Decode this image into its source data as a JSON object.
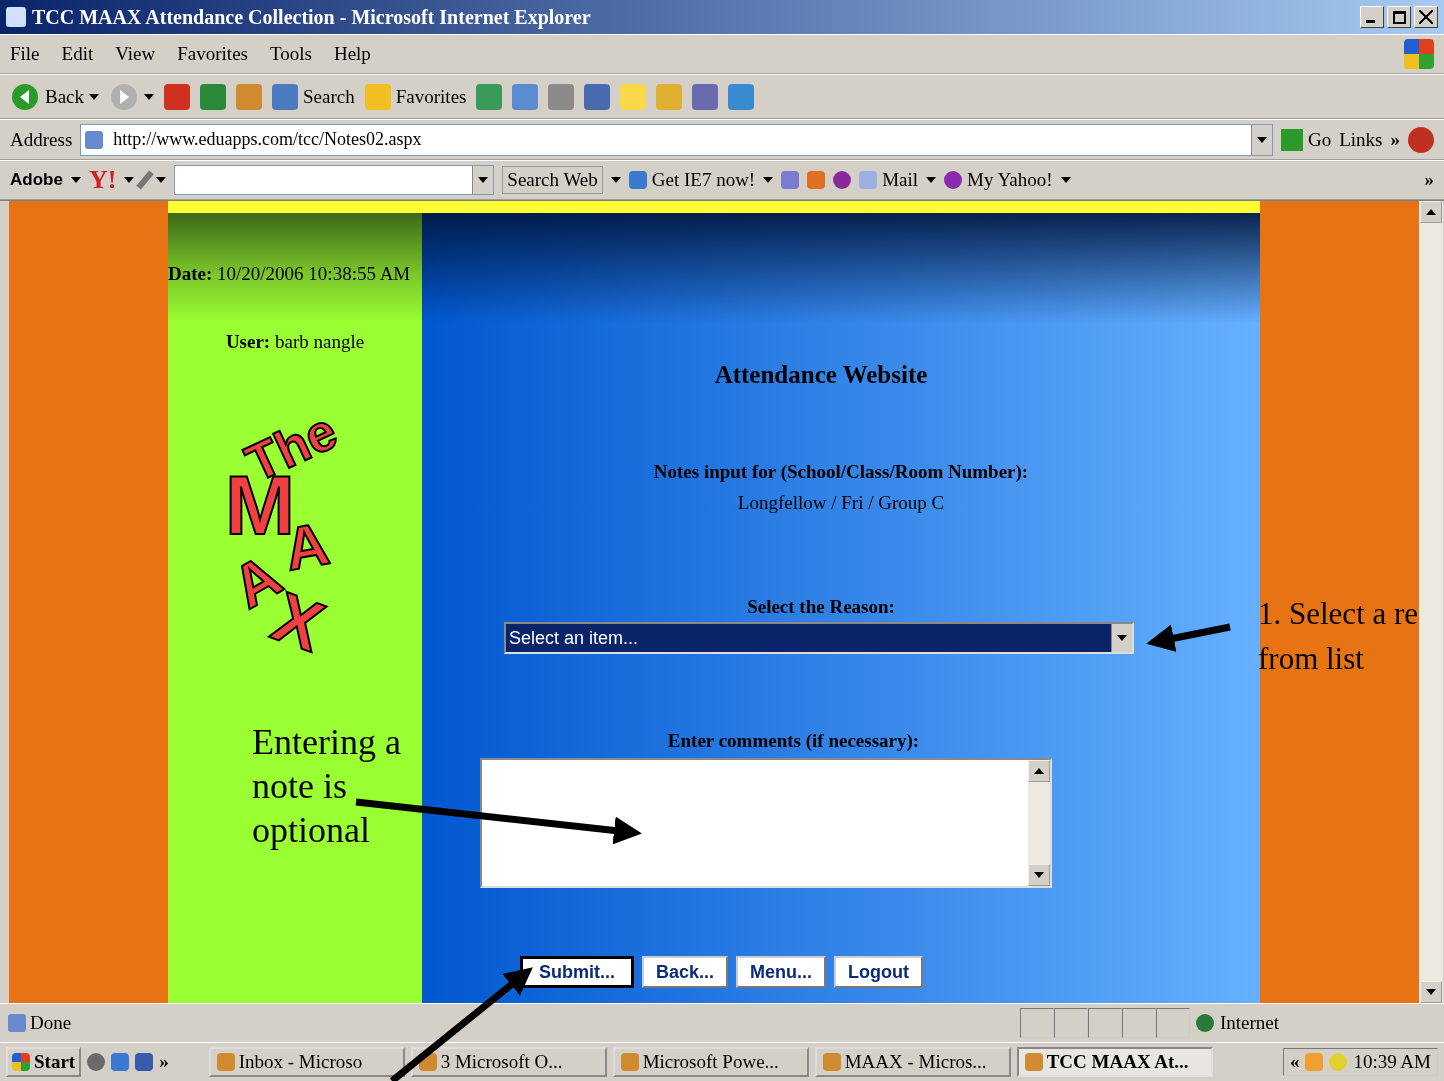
{
  "window": {
    "title": "TCC MAAX Attendance Collection - Microsoft Internet Explorer"
  },
  "menu": [
    "File",
    "Edit",
    "View",
    "Favorites",
    "Tools",
    "Help"
  ],
  "toolbar": [
    {
      "kind": "back",
      "label": "Back"
    },
    {
      "kind": "forward"
    },
    {
      "kind": "stop"
    },
    {
      "kind": "refresh"
    },
    {
      "kind": "home"
    },
    {
      "kind": "search",
      "label": "Search"
    },
    {
      "kind": "favorites",
      "label": "Favorites"
    },
    {
      "kind": "history"
    },
    {
      "kind": "mail"
    },
    {
      "kind": "print"
    },
    {
      "kind": "edit"
    },
    {
      "kind": "note"
    },
    {
      "kind": "star"
    },
    {
      "kind": "research"
    },
    {
      "kind": "messenger"
    }
  ],
  "address": {
    "label": "Address",
    "url": "http://www.eduapps.com/tcc/Notes02.aspx",
    "go": "Go",
    "links": "Links",
    "more": "»"
  },
  "toolbar2": {
    "adobe": "Adobe",
    "yahoo": "Y!",
    "search_web": "Search Web",
    "ie7": "Get IE7 now!",
    "mail": "Mail",
    "my_yahoo": "My Yahoo!",
    "more": "»"
  },
  "page": {
    "date_label": "Date:",
    "date_value": "10/20/2006 10:38:55 AM",
    "user_label": "User:",
    "user_value": "barb nangle",
    "logo": [
      "The",
      "M",
      "A",
      "A",
      "X"
    ],
    "heading": "Attendance Website",
    "notes_label": "Notes input for (School/Class/Room Number):",
    "notes_value": "Longfellow / Fri / Group C",
    "reason_label": "Select the Reason:",
    "reason_value": "Select an item...",
    "comments_label": "Enter comments (if necessary):",
    "buttons": [
      {
        "label": "Submit...",
        "selected": true
      },
      {
        "label": "Back...",
        "selected": false
      },
      {
        "label": "Menu...",
        "selected": false
      },
      {
        "label": "Logout",
        "selected": false
      }
    ]
  },
  "annotations": {
    "left": "Entering a note is optional",
    "right_1": "1. Select a re",
    "right_2": "from list"
  },
  "status_bar": {
    "status": "Done",
    "zone": "Internet"
  },
  "taskbar": {
    "start": "Start",
    "more": "»",
    "tasks": [
      {
        "label": "Inbox - Microso",
        "selected": false
      },
      {
        "label": "3 Microsoft O...",
        "selected": false
      },
      {
        "label": "Microsoft Powe...",
        "selected": false
      },
      {
        "label": "MAAX - Micros...",
        "selected": false
      },
      {
        "label": "TCC MAAX At...",
        "selected": true
      }
    ],
    "tray_more": "«",
    "clock": "10:39 AM"
  }
}
